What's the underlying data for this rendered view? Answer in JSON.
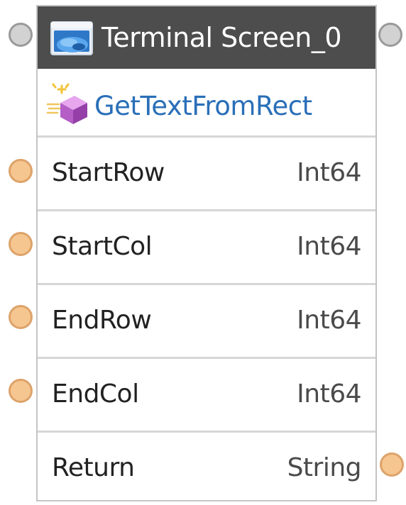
{
  "node": {
    "title": "Terminal Screen_0",
    "title_icon": "terminal-screen-icon",
    "method": {
      "label": "GetTextFromRect",
      "icon": "method-icon"
    },
    "inputs": [
      {
        "name": "StartRow",
        "type": "Int64"
      },
      {
        "name": "StartCol",
        "type": "Int64"
      },
      {
        "name": "EndRow",
        "type": "Int64"
      },
      {
        "name": "EndCol",
        "type": "Int64"
      }
    ],
    "output": {
      "name": "Return",
      "type": "String"
    }
  },
  "colors": {
    "header_bg": "#4d4d4d",
    "method_text": "#2a6fb8",
    "data_port": "#f6c690",
    "exec_port": "#d2d2d2"
  }
}
